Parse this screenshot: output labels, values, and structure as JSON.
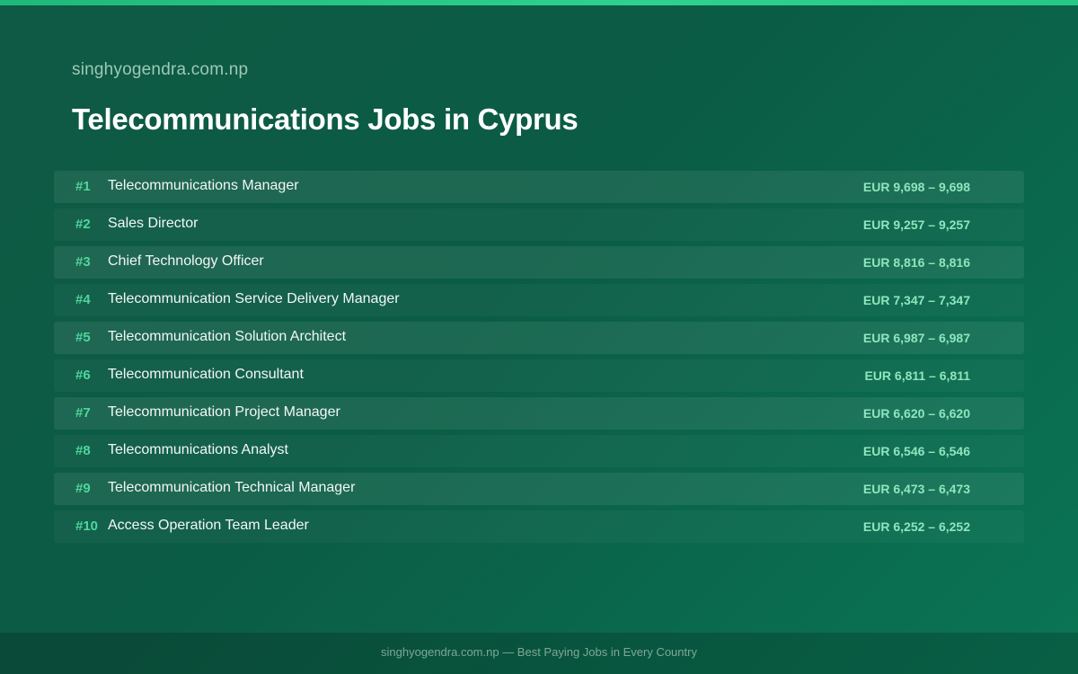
{
  "header": {
    "site_name": "singhyogendra.com.np",
    "title": "Telecommunications Jobs in Cyprus"
  },
  "jobs": [
    {
      "rank": "#1",
      "title": "Telecommunications Manager",
      "salary": "EUR 9,698 – 9,698"
    },
    {
      "rank": "#2",
      "title": "Sales Director",
      "salary": "EUR 9,257 – 9,257"
    },
    {
      "rank": "#3",
      "title": "Chief Technology Officer",
      "salary": "EUR 8,816 – 8,816"
    },
    {
      "rank": "#4",
      "title": "Telecommunication Service Delivery Manager",
      "salary": "EUR 7,347 – 7,347"
    },
    {
      "rank": "#5",
      "title": "Telecommunication Solution Architect",
      "salary": "EUR 6,987 – 6,987"
    },
    {
      "rank": "#6",
      "title": "Telecommunication Consultant",
      "salary": "EUR 6,811 – 6,811"
    },
    {
      "rank": "#7",
      "title": "Telecommunication Project Manager",
      "salary": "EUR 6,620 – 6,620"
    },
    {
      "rank": "#8",
      "title": "Telecommunications Analyst",
      "salary": "EUR 6,546 – 6,546"
    },
    {
      "rank": "#9",
      "title": "Telecommunication Technical Manager",
      "salary": "EUR 6,473 – 6,473"
    },
    {
      "rank": "#10",
      "title": "Access Operation Team Leader",
      "salary": "EUR 6,252 – 6,252"
    }
  ],
  "footer": {
    "text": "singhyogendra.com.np — Best Paying Jobs in Every Country"
  },
  "colors": {
    "accent": "#2ed28e",
    "rank": "#4fd69c",
    "salary": "#8fe5bd",
    "background": "#0b5c45"
  }
}
